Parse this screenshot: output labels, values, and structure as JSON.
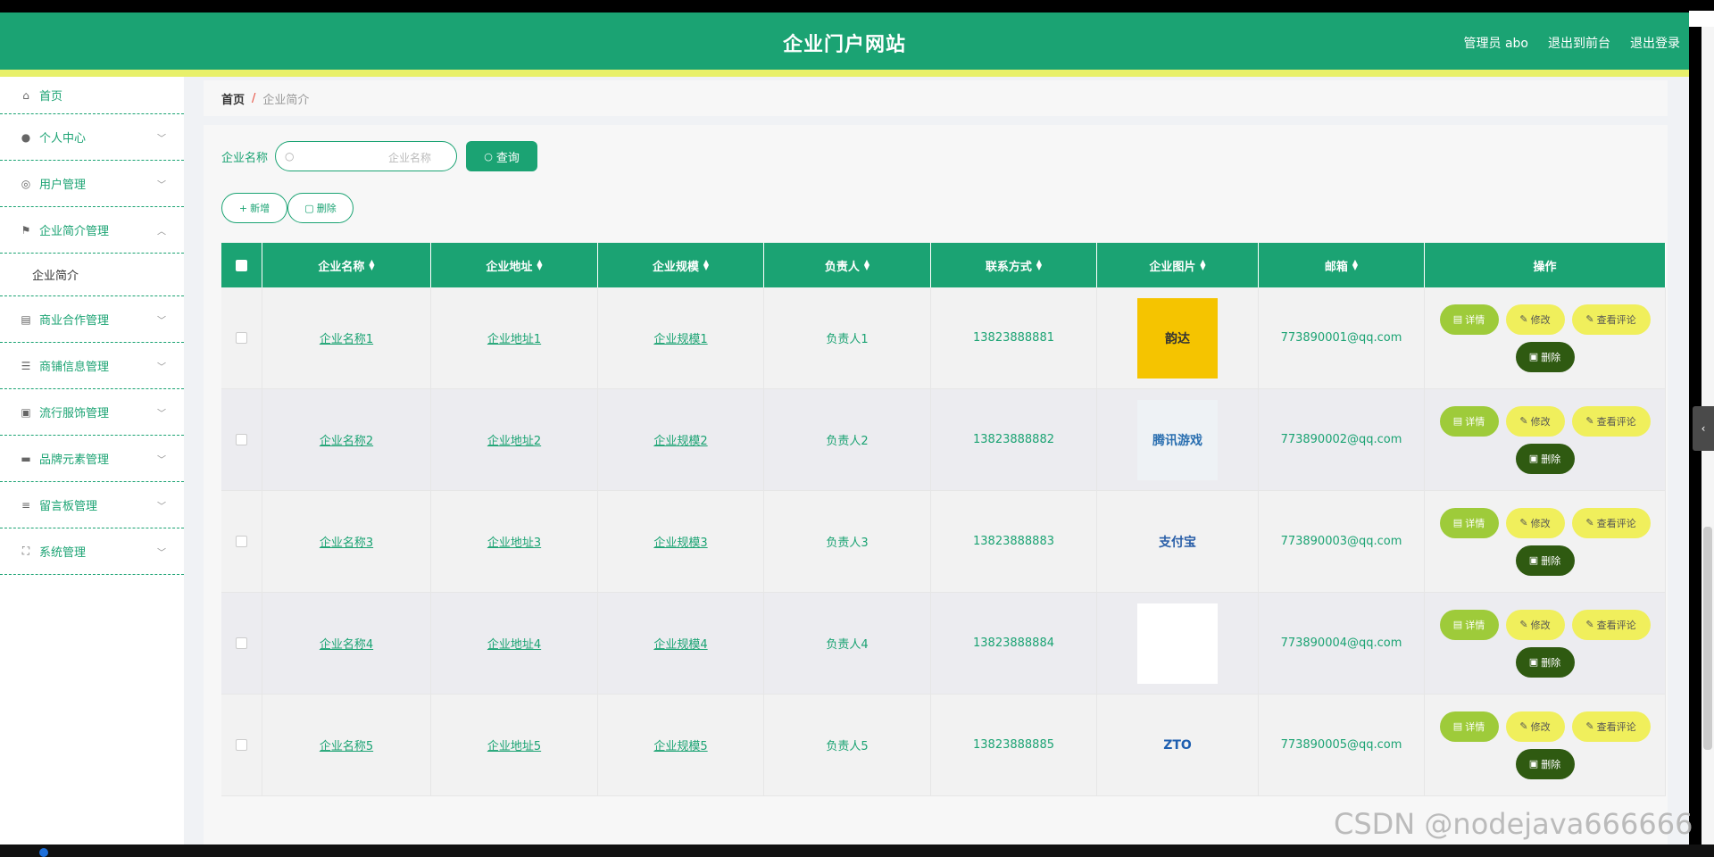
{
  "header": {
    "title": "企业门户网站",
    "admin": "管理员 abo",
    "back_front": "退出到前台",
    "logout": "退出登录"
  },
  "sidebar": {
    "items": [
      {
        "label": "首页",
        "icon": "home-icon"
      },
      {
        "label": "个人中心",
        "icon": "user-icon"
      },
      {
        "label": "用户管理",
        "icon": "gauge-icon"
      },
      {
        "label": "企业简介管理",
        "icon": "flag-icon"
      },
      {
        "label": "商业合作管理",
        "icon": "chart-icon"
      },
      {
        "label": "商铺信息管理",
        "icon": "list-icon"
      },
      {
        "label": "流行服饰管理",
        "icon": "clipboard-icon"
      },
      {
        "label": "品牌元素管理",
        "icon": "box-icon"
      },
      {
        "label": "留言板管理",
        "icon": "sliders-icon"
      },
      {
        "label": "系统管理",
        "icon": "expand-icon"
      }
    ],
    "sub_item": "企业简介"
  },
  "breadcrumb": {
    "home": "首页",
    "sep": "/",
    "current": "企业简介"
  },
  "search": {
    "label": "企业名称",
    "placeholder": "企业名称",
    "button": "查询"
  },
  "actions": {
    "add": "新增",
    "delete": "删除"
  },
  "table": {
    "headers": [
      "企业名称",
      "企业地址",
      "企业规模",
      "负责人",
      "联系方式",
      "企业图片",
      "邮箱",
      "操作"
    ],
    "rows": [
      {
        "name": "企业名称1",
        "addr": "企业地址1",
        "scale": "企业规模1",
        "owner": "负责人1",
        "phone": "13823888881",
        "img": "韵达",
        "email": "773890001@qq.com"
      },
      {
        "name": "企业名称2",
        "addr": "企业地址2",
        "scale": "企业规模2",
        "owner": "负责人2",
        "phone": "13823888882",
        "img": "腾讯游戏",
        "email": "773890002@qq.com"
      },
      {
        "name": "企业名称3",
        "addr": "企业地址3",
        "scale": "企业规模3",
        "owner": "负责人3",
        "phone": "13823888883",
        "img": "支付宝",
        "email": "773890003@qq.com"
      },
      {
        "name": "企业名称4",
        "addr": "企业地址4",
        "scale": "企业规模4",
        "owner": "负责人4",
        "phone": "13823888884",
        "img": "",
        "email": "773890004@qq.com"
      },
      {
        "name": "企业名称5",
        "addr": "企业地址5",
        "scale": "企业规模5",
        "owner": "负责人5",
        "phone": "13823888885",
        "img": "ZTO",
        "email": "773890005@qq.com"
      }
    ],
    "ops": {
      "detail": "详情",
      "edit": "修改",
      "review": "查看评论",
      "delete": "删除"
    }
  },
  "watermark": "CSDN @nodejava666666",
  "colors": {
    "primary": "#1ba373",
    "accent_yellow": "#e8f06a",
    "detail_btn": "#9ecb3a",
    "edit_btn": "#f0ef5c",
    "delete_btn": "#2f5a11"
  }
}
